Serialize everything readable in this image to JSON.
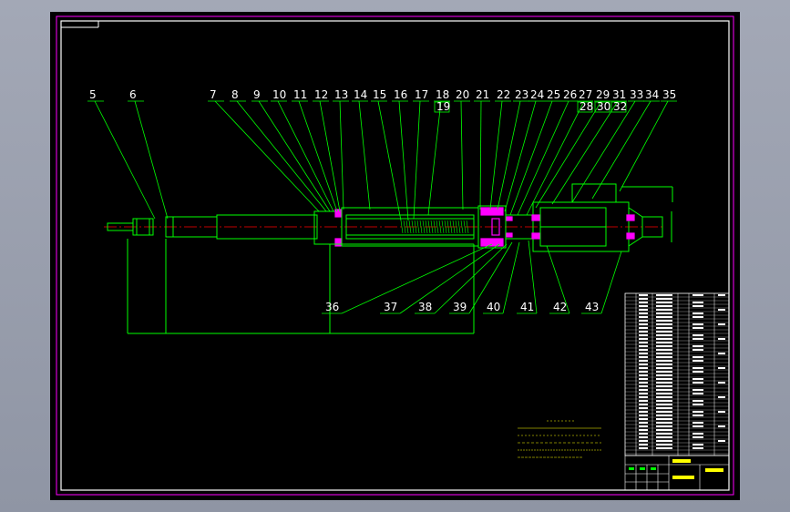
{
  "drawing": {
    "top_labels": [
      "5",
      "6",
      "7",
      "8",
      "9",
      "10",
      "11",
      "12",
      "13",
      "14",
      "15",
      "16",
      "17",
      "18",
      "20",
      "21",
      "22",
      "23",
      "24",
      "25",
      "26",
      "27",
      "29",
      "31",
      "33",
      "34",
      "35"
    ],
    "sub_labels": [
      "19",
      "28",
      "30",
      "32"
    ],
    "bottom_labels": [
      "36",
      "37",
      "38",
      "39",
      "40",
      "41",
      "42",
      "43"
    ],
    "colors": {
      "background": "#000000",
      "frame": "#ff00ff",
      "geometry": "#00ff00",
      "leader": "#00ff00",
      "text": "#ffffff",
      "centerline": "#ff0000",
      "hatch": "#ff00ff",
      "note": "#ffff00"
    }
  }
}
